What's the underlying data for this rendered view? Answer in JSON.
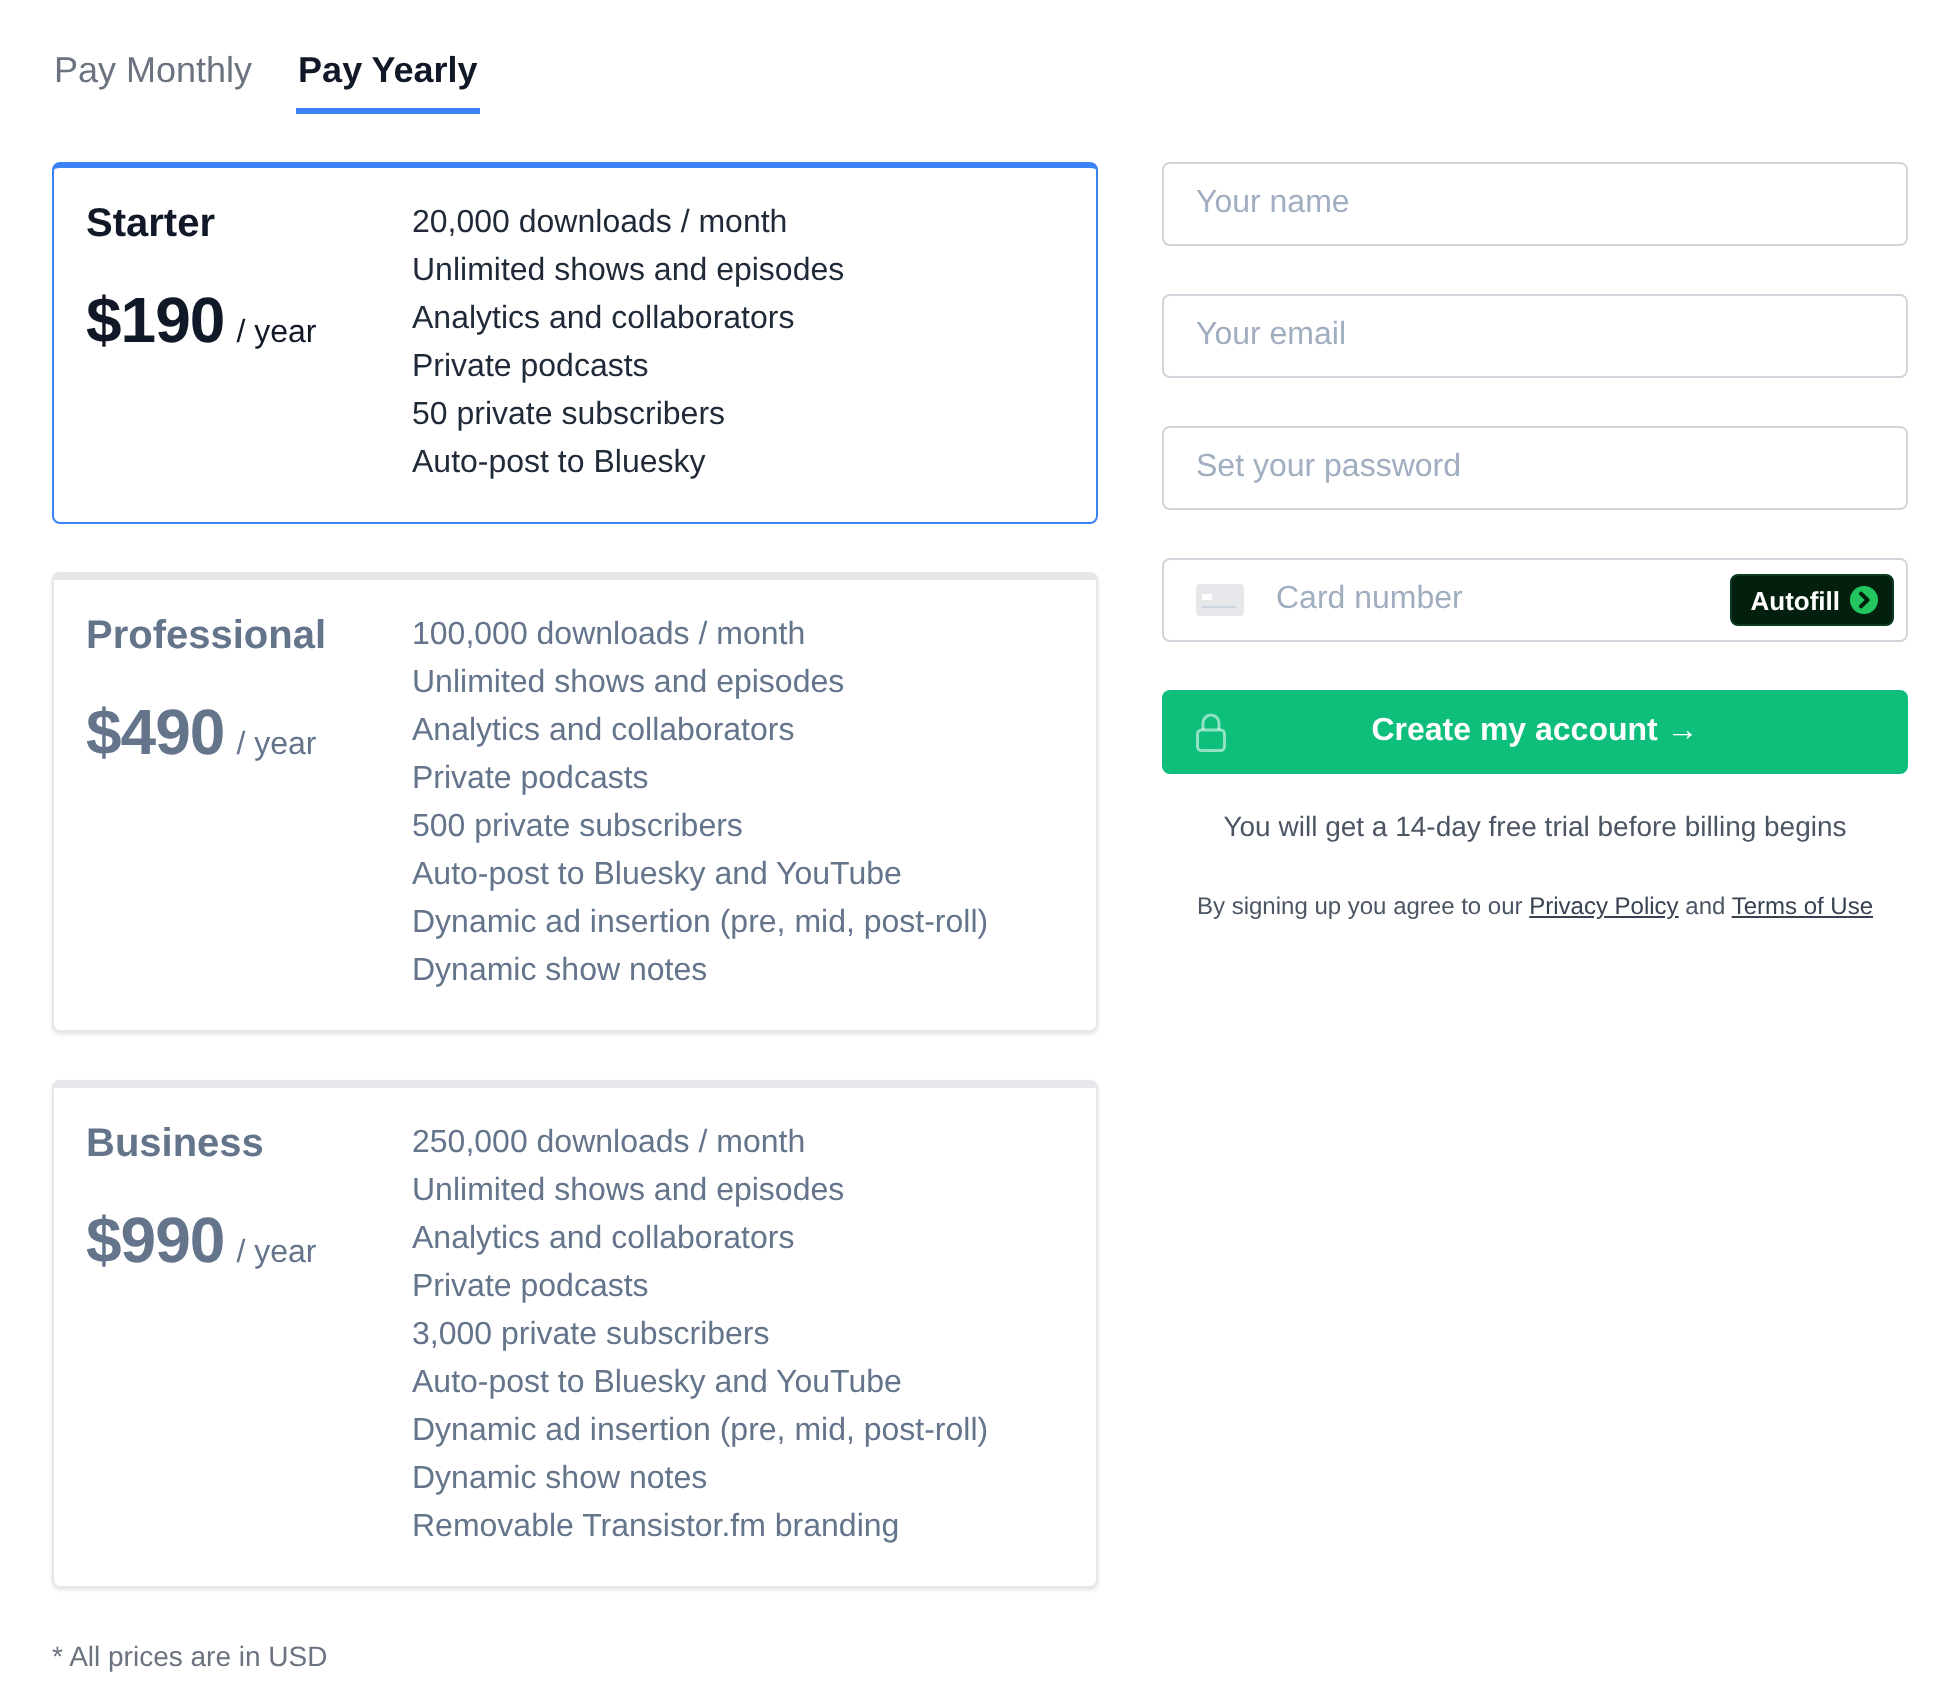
{
  "tabs": [
    {
      "label": "Pay Monthly",
      "selected": false
    },
    {
      "label": "Pay Yearly",
      "selected": true
    }
  ],
  "plans": [
    {
      "name": "Starter",
      "price": "$190",
      "period": "/ year",
      "selected": true,
      "features": [
        "20,000 downloads / month",
        "Unlimited shows and episodes",
        "Analytics and collaborators",
        "Private podcasts",
        "50 private subscribers",
        "Auto-post to Bluesky"
      ]
    },
    {
      "name": "Professional",
      "price": "$490",
      "period": "/ year",
      "selected": false,
      "features": [
        "100,000 downloads / month",
        "Unlimited shows and episodes",
        "Analytics and collaborators",
        "Private podcasts",
        "500 private subscribers",
        "Auto-post to Bluesky and YouTube",
        "Dynamic ad insertion (pre, mid, post-roll)",
        "Dynamic show notes"
      ]
    },
    {
      "name": "Business",
      "price": "$990",
      "period": "/ year",
      "selected": false,
      "features": [
        "250,000 downloads / month",
        "Unlimited shows and episodes",
        "Analytics and collaborators",
        "Private podcasts",
        "3,000 private subscribers",
        "Auto-post to Bluesky and YouTube",
        "Dynamic ad insertion (pre, mid, post-roll)",
        "Dynamic show notes",
        "Removable Transistor.fm branding"
      ]
    }
  ],
  "footnote": "* All prices are in USD",
  "signup_form": {
    "fields": [
      {
        "kind": "text",
        "placeholder": "Your name"
      },
      {
        "kind": "text",
        "placeholder": "Your email"
      },
      {
        "kind": "password",
        "placeholder": "Set your password"
      },
      {
        "kind": "card",
        "placeholder": "Card number",
        "action": "Autofill"
      }
    ],
    "submit_button": "Create my account →",
    "trial_note": "You will get a 14-day free trial before billing begins",
    "legal": {
      "prefix": "By signing up you agree to our",
      "links": [
        "Privacy Policy",
        "Terms of Use"
      ],
      "joiner": "and"
    }
  }
}
